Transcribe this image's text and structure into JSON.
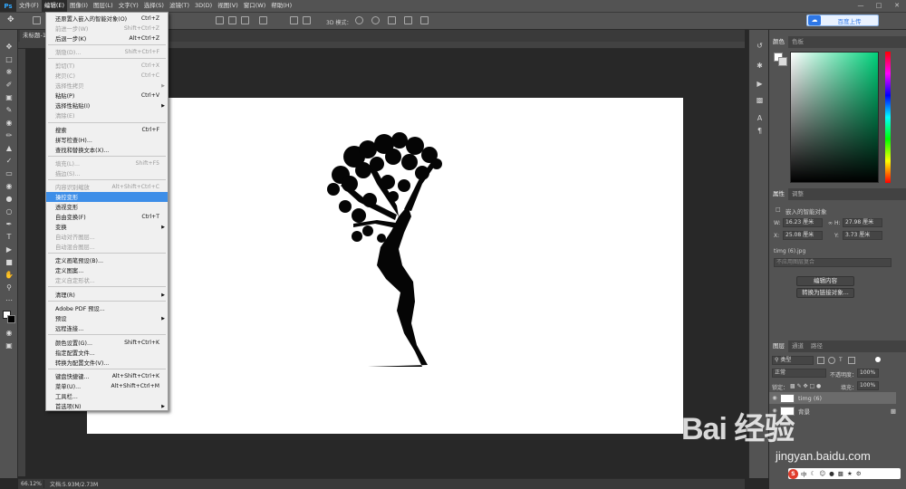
{
  "menubar": {
    "items": [
      {
        "label": "文件(F)"
      },
      {
        "label": "编辑(E)"
      },
      {
        "label": "图像(I)"
      },
      {
        "label": "图层(L)"
      },
      {
        "label": "文字(Y)"
      },
      {
        "label": "选择(S)"
      },
      {
        "label": "滤镜(T)"
      },
      {
        "label": "3D(D)"
      },
      {
        "label": "视图(V)"
      },
      {
        "label": "窗口(W)"
      },
      {
        "label": "帮助(H)"
      }
    ],
    "logo": "Ps"
  },
  "optbar": {
    "mode_label": "3D 模式：",
    "cloud_upload": "百度上传"
  },
  "document": {
    "tab_title": "未标题-1 @ 66.1% (timg (6), RGB/8)",
    "zoom": "66.12%",
    "doc_size": "文档:5.93M/2.73M"
  },
  "edit_menu": {
    "items": [
      {
        "label": "还原置入嵌入的智能对象(O)",
        "shortcut": "Ctrl+Z",
        "disabled": false
      },
      {
        "label": "前进一步(W)",
        "shortcut": "Shift+Ctrl+Z",
        "disabled": true
      },
      {
        "label": "后退一步(K)",
        "shortcut": "Alt+Ctrl+Z",
        "disabled": false
      },
      {
        "label": "渐隐(D)...",
        "shortcut": "Shift+Ctrl+F",
        "disabled": true
      },
      {
        "label": "剪切(T)",
        "shortcut": "Ctrl+X",
        "disabled": true
      },
      {
        "label": "拷贝(C)",
        "shortcut": "Ctrl+C",
        "disabled": true
      },
      {
        "label": "选择性拷贝",
        "shortcut": "",
        "disabled": true,
        "submenu": true
      },
      {
        "label": "粘贴(P)",
        "shortcut": "Ctrl+V",
        "disabled": false
      },
      {
        "label": "选择性粘贴(I)",
        "shortcut": "",
        "disabled": false,
        "submenu": true
      },
      {
        "label": "清除(E)",
        "shortcut": "",
        "disabled": true
      },
      {
        "label": "搜索",
        "shortcut": "Ctrl+F",
        "disabled": false
      },
      {
        "label": "拼写检查(H)...",
        "shortcut": "",
        "disabled": false
      },
      {
        "label": "查找和替换文本(X)...",
        "shortcut": "",
        "disabled": false
      },
      {
        "label": "填充(L)...",
        "shortcut": "Shift+F5",
        "disabled": true
      },
      {
        "label": "描边(S)...",
        "shortcut": "",
        "disabled": true
      },
      {
        "label": "内容识别缩放",
        "shortcut": "Alt+Shift+Ctrl+C",
        "disabled": true
      },
      {
        "label": "操控变形",
        "shortcut": "",
        "disabled": false,
        "highlighted": true
      },
      {
        "label": "透视变形",
        "shortcut": "",
        "disabled": false
      },
      {
        "label": "自由变换(F)",
        "shortcut": "Ctrl+T",
        "disabled": false
      },
      {
        "label": "变换",
        "shortcut": "",
        "disabled": false,
        "submenu": true
      },
      {
        "label": "自动对齐图层...",
        "shortcut": "",
        "disabled": true
      },
      {
        "label": "自动混合图层...",
        "shortcut": "",
        "disabled": true
      },
      {
        "label": "定义画笔预设(B)...",
        "shortcut": "",
        "disabled": false
      },
      {
        "label": "定义图案...",
        "shortcut": "",
        "disabled": false
      },
      {
        "label": "定义自定形状...",
        "shortcut": "",
        "disabled": true
      },
      {
        "label": "清理(R)",
        "shortcut": "",
        "disabled": false,
        "submenu": true
      },
      {
        "label": "Adobe PDF 预设...",
        "shortcut": "",
        "disabled": false
      },
      {
        "label": "预设",
        "shortcut": "",
        "disabled": false,
        "submenu": true
      },
      {
        "label": "远程连接...",
        "shortcut": "",
        "disabled": false
      },
      {
        "label": "颜色设置(G)...",
        "shortcut": "Shift+Ctrl+K",
        "disabled": false
      },
      {
        "label": "指定配置文件...",
        "shortcut": "",
        "disabled": false
      },
      {
        "label": "转换为配置文件(V)...",
        "shortcut": "",
        "disabled": false
      },
      {
        "label": "键盘快捷键...",
        "shortcut": "Alt+Shift+Ctrl+K",
        "disabled": false
      },
      {
        "label": "菜单(U)...",
        "shortcut": "Alt+Shift+Ctrl+M",
        "disabled": false
      },
      {
        "label": "工具栏...",
        "shortcut": "",
        "disabled": false
      },
      {
        "label": "首选项(N)",
        "shortcut": "",
        "disabled": false,
        "submenu": true
      }
    ]
  },
  "color_panel": {
    "tabs": [
      "颜色",
      "色板"
    ]
  },
  "properties_panel": {
    "tabs": [
      "属性",
      "调整"
    ],
    "kind": "嵌入的智能对象",
    "w_label": "W:",
    "w_value": "16.23 厘米",
    "h_label": "H:",
    "h_value": "27.98 厘米",
    "x_label": "X:",
    "x_value": "25.08 厘米",
    "y_label": "Y:",
    "y_value": "3.73 厘米",
    "file": "timg (6).jpg",
    "comp_placeholder": "不应用图层复合",
    "edit_contents": "编辑内容",
    "convert_linked": "转换为链接对象..."
  },
  "layers_panel": {
    "tabs": [
      "图层",
      "通道",
      "路径"
    ],
    "filter": "类型",
    "blend_mode": "正常",
    "opacity_label": "不透明度：",
    "opacity": "100%",
    "lock_label": "锁定：",
    "fill_label": "填充：",
    "fill": "100%",
    "layers": [
      {
        "name": "timg (6)"
      },
      {
        "name": "背景"
      }
    ]
  },
  "watermark": {
    "brand": "Bai  经验",
    "url": "jingyan.baidu.com"
  },
  "ime": {
    "label": "中"
  }
}
